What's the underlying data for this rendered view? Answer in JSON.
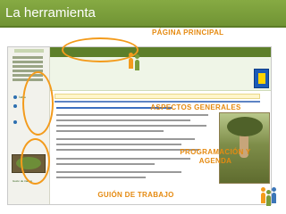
{
  "slide": {
    "title": "La herramienta",
    "callouts": {
      "pagina_principal": "PÁGINA PRINCIPAL",
      "aspectos_generales": "ASPECTOS GENERALES",
      "programacion_line1": "PROGRAMACIÓN Y",
      "programacion_line2": "AGENDA",
      "guion_de_trabajo": "GUIÓN DE TRABAJO"
    }
  },
  "colors": {
    "header_green": "#7a9c3a",
    "callout_orange": "#f39b1c"
  },
  "screenshot": {
    "banner_text": "Bienvenidos al espacio donde vais a crear vuestro propio proyecto",
    "section_heading": "¿Qué vais a crear? Aquí va el proyecto",
    "side_labels": [
      "Índice",
      "Guión de trabajo"
    ]
  }
}
